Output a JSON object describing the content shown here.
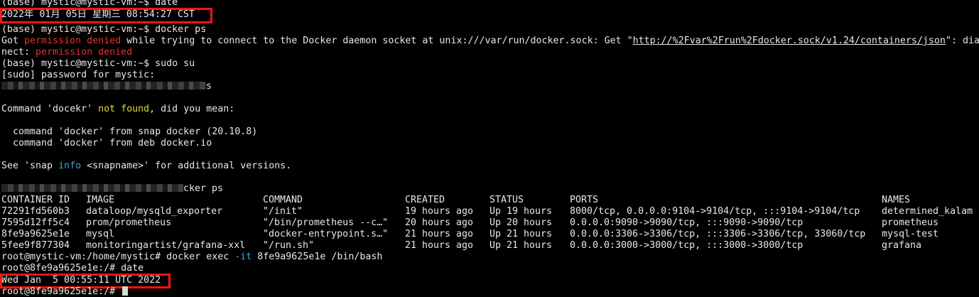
{
  "lines": {
    "l0": "(base) mystic@mystic-vm:~$ date",
    "l1": "2022年 01月 05日 星期三 08:54:27 CST",
    "l2": "(base) mystic@mystic-vm:~$ docker ps",
    "l3_a": "Got ",
    "l3_err": "permission denied",
    "l3_b": " while trying to connect to the Docker daemon socket at unix:///var/run/docker.sock: Get \"",
    "l3_link": "http://%2Fvar%2Frun%2Fdocker.sock/v1.24/containers/json",
    "l3_c": "\": dia",
    "l4_a": "nect: ",
    "l4_err": "permission denied",
    "l5": "(base) mystic@mystic-vm:~$ sudo su",
    "l6": "[sudo] password for mystic:",
    "l7_tail": "s",
    "l9_a": "Command 'docekr' ",
    "l9_nf": "not found",
    "l9_b": ", did you mean:",
    "l11": "  command 'docker' from snap docker (20.10.8)",
    "l12": "  command 'docker' from deb docker.io",
    "l14_a": "See 'snap ",
    "l14_info": "info",
    "l14_b": " <snapname>' for additional versions.",
    "l16_tail": "cker ps",
    "l22_a": "root@mystic-vm:/home/mystic# docker exec ",
    "l22_flag": "-it",
    "l22_b": " 8fe9a9625e1e /bin/bash",
    "l23": "root@8fe9a9625e1e:/# date",
    "l24": "Wed Jan  5 00:55:11 UTC 2022",
    "l25": "root@8fe9a9625e1e:/# "
  },
  "table": {
    "headers": [
      "CONTAINER ID",
      "IMAGE",
      "COMMAND",
      "CREATED",
      "STATUS",
      "PORTS",
      "NAMES"
    ],
    "rows": [
      [
        "72291fd560b3",
        "dataloop/mysqld_exporter",
        "\"/init\"",
        "19 hours ago",
        "Up 19 hours",
        "8000/tcp, 0.0.0.0:9104->9104/tcp, :::9104->9104/tcp",
        "determined_kalam"
      ],
      [
        "7595d12ff5c4",
        "prom/prometheus",
        "\"/bin/prometheus --c…\"",
        "20 hours ago",
        "Up 20 hours",
        "0.0.0.0:9090->9090/tcp, :::9090->9090/tcp",
        "prometheus"
      ],
      [
        "8fe9a9625e1e",
        "mysql",
        "\"docker-entrypoint.s…\"",
        "21 hours ago",
        "Up 21 hours",
        "0.0.0.0:3306->3306/tcp, :::3306->3306/tcp, 33060/tcp",
        "mysql-test"
      ],
      [
        "5fee9f877304",
        "monitoringartist/grafana-xxl",
        "\"/run.sh\"",
        "21 hours ago",
        "Up 21 hours",
        "0.0.0.0:3000->3000/tcp, :::3000->3000/tcp",
        "grafana"
      ]
    ]
  },
  "colors": {
    "background": "#000000",
    "text": "#e8e8e8",
    "error": "#e0342c",
    "not_found": "#e3d84a",
    "info": "#3aa6d8",
    "highlight_box": "#ff1414"
  }
}
